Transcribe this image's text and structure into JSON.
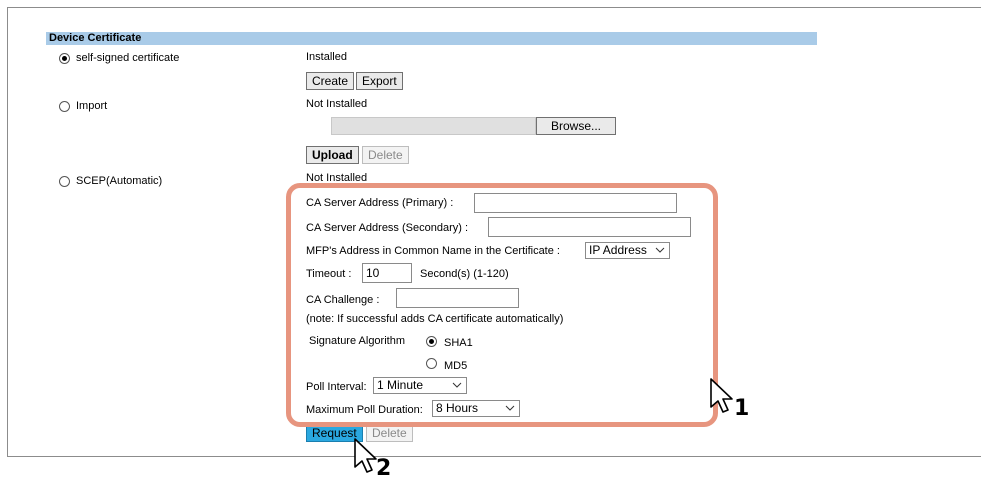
{
  "section": {
    "title": "Device Certificate"
  },
  "options": {
    "self_signed": {
      "label": "self-signed certificate",
      "status": "Installed",
      "selected": true,
      "buttons": {
        "create": "Create",
        "export": "Export"
      }
    },
    "import": {
      "label": "Import",
      "status": "Not Installed",
      "selected": false,
      "browse": "Browse...",
      "buttons": {
        "upload": "Upload",
        "delete": "Delete"
      }
    },
    "scep": {
      "label": "SCEP(Automatic)",
      "status": "Not Installed",
      "selected": false
    }
  },
  "scep_form": {
    "primary_label": "CA Server Address (Primary) :",
    "primary_value": "",
    "secondary_label": "CA Server Address (Secondary) :",
    "secondary_value": "",
    "common_name_label": "MFP's Address in Common Name in the Certificate :",
    "common_name_value": "IP Address",
    "timeout_label": "Timeout :",
    "timeout_value": "10",
    "timeout_unit": "Second(s) (1-120)",
    "challenge_label": "CA Challenge :",
    "challenge_value": "",
    "note": "(note: If successful adds CA certificate automatically)",
    "signature_label": "Signature Algorithm",
    "sha1": "SHA1",
    "md5": "MD5",
    "poll_interval_label": "Poll Interval:",
    "poll_interval_value": "1 Minute",
    "max_poll_label": "Maximum Poll Duration:",
    "max_poll_value": "8 Hours",
    "request_button": "Request",
    "delete_button": "Delete"
  },
  "callouts": {
    "one": "1",
    "two": "2"
  },
  "colors": {
    "header": "#a9cbe8",
    "highlight": "#e7957f",
    "request_active": "#2aa8e0"
  }
}
